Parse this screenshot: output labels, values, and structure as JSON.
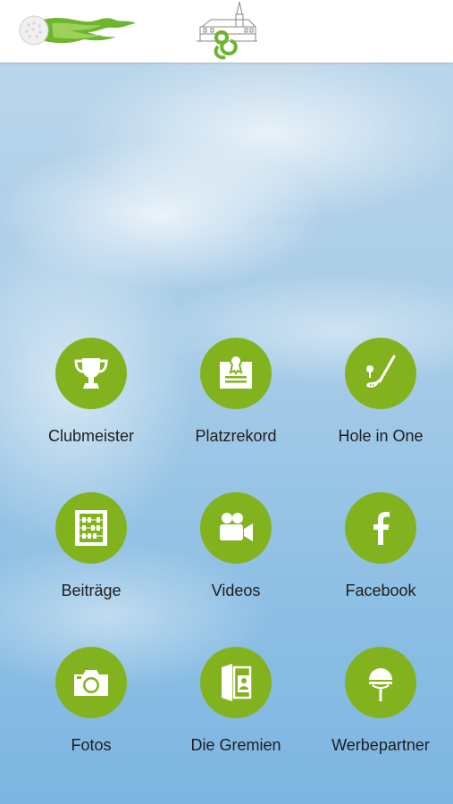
{
  "header": {
    "logo_left_icon": "golf-ball-flame-logo",
    "logo_center_icon": "club-crest-logo"
  },
  "colors": {
    "accent": "#82b31e",
    "header_bg": "#ffffff",
    "label": "#1e1e1e"
  },
  "tiles": [
    {
      "label": "Clubmeister",
      "icon": "trophy-icon"
    },
    {
      "label": "Platzrekord",
      "icon": "certificate-icon"
    },
    {
      "label": "Hole in One",
      "icon": "golf-club-icon"
    },
    {
      "label": "Beiträge",
      "icon": "abacus-icon"
    },
    {
      "label": "Videos",
      "icon": "video-camera-icon"
    },
    {
      "label": "Facebook",
      "icon": "facebook-icon"
    },
    {
      "label": "Fotos",
      "icon": "camera-icon"
    },
    {
      "label": "Die Gremien",
      "icon": "contact-card-icon"
    },
    {
      "label": "Werbepartner",
      "icon": "lollipop-icon"
    }
  ]
}
